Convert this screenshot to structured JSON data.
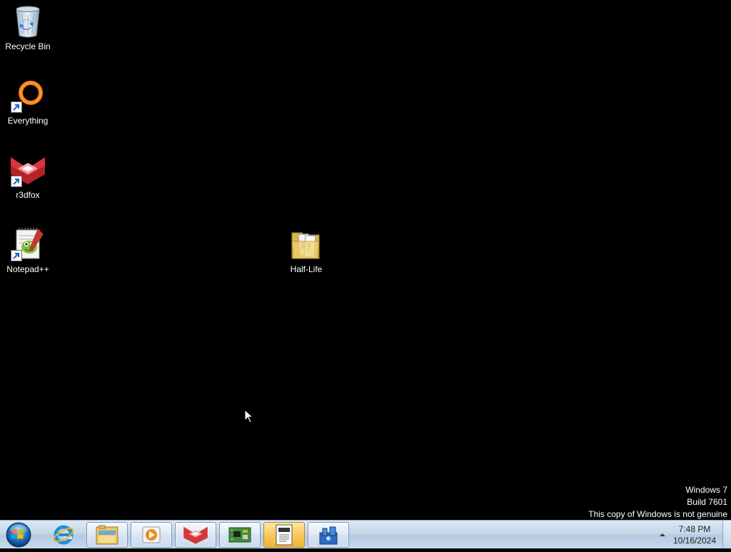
{
  "desktop": {
    "icons": [
      {
        "label": "Recycle Bin",
        "icon": "recycle-bin-icon"
      },
      {
        "label": "Everything",
        "icon": "everything-search-icon"
      },
      {
        "label": "r3dfox",
        "icon": "r3dfox-browser-icon"
      },
      {
        "label": "Notepad++",
        "icon": "notepad-plus-plus-icon"
      },
      {
        "label": "Half-Life",
        "icon": "folder-icon"
      }
    ],
    "watermark": {
      "line1": "Windows 7",
      "line2": "Build 7601",
      "line3": "This copy of Windows is not genuine"
    }
  },
  "taskbar": {
    "start_icon": "windows-start-orb-icon",
    "buttons": [
      {
        "name": "internet-explorer",
        "icon": "internet-explorer-icon",
        "state": "pinned"
      },
      {
        "name": "windows-explorer",
        "icon": "folder-library-icon",
        "state": "open"
      },
      {
        "name": "windows-media-player",
        "icon": "media-player-icon",
        "state": "open"
      },
      {
        "name": "r3dfox",
        "icon": "r3dfox-browser-icon",
        "state": "open"
      },
      {
        "name": "system-board",
        "icon": "circuit-board-icon",
        "state": "open"
      },
      {
        "name": "notepad-document",
        "icon": "notepad-document-icon",
        "state": "active"
      },
      {
        "name": "remote-app",
        "icon": "network-computer-icon",
        "state": "open"
      }
    ],
    "clock": {
      "time": "7:48 PM",
      "date": "10/16/2024"
    },
    "colors": {
      "taskbar": "#c6d7ea",
      "active_button": "#f8c95a",
      "desktop": "#000000"
    }
  }
}
